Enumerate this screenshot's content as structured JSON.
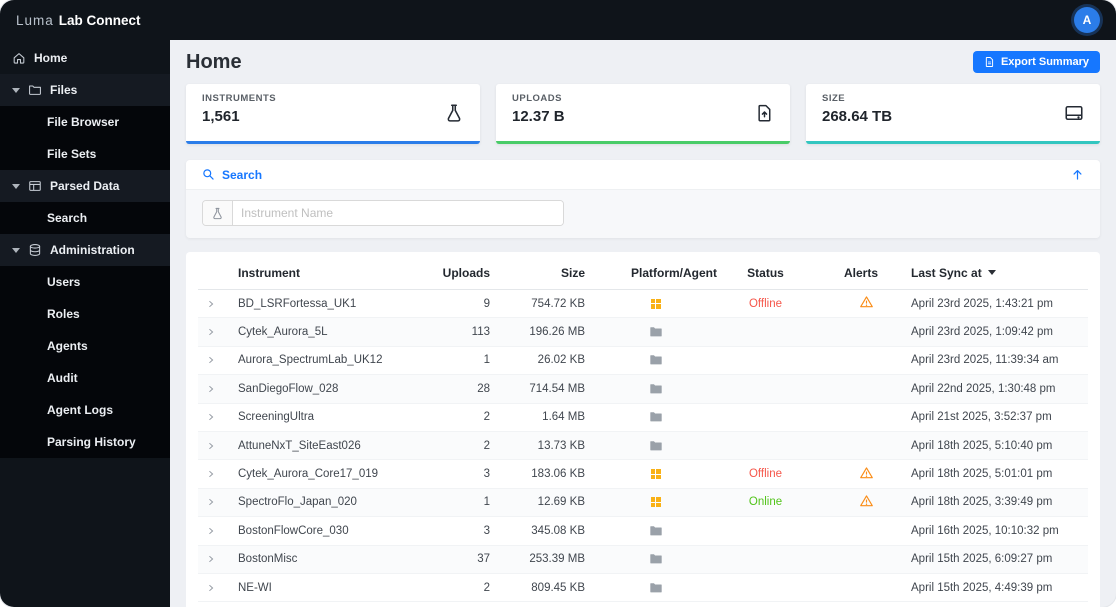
{
  "header": {
    "logo_primary": "Luma",
    "logo_secondary": "Lab Connect",
    "avatar_initial": "A"
  },
  "sidebar": {
    "home_label": "Home",
    "groups": [
      {
        "label": "Files",
        "children": [
          "File Browser",
          "File Sets"
        ]
      },
      {
        "label": "Parsed Data",
        "children": [
          "Search"
        ]
      },
      {
        "label": "Administration",
        "children": [
          "Users",
          "Roles",
          "Agents",
          "Audit",
          "Agent Logs",
          "Parsing History"
        ]
      }
    ]
  },
  "main": {
    "title": "Home",
    "export_button_label": "Export Summary",
    "cards": [
      {
        "label": "INSTRUMENTS",
        "value": "1,561",
        "icon": "instrument-icon",
        "accent": "#2b7de9"
      },
      {
        "label": "UPLOADS",
        "value": "12.37 B",
        "icon": "upload-file-icon",
        "accent": "#49cc68"
      },
      {
        "label": "SIZE",
        "value": "268.64 TB",
        "icon": "storage-icon",
        "accent": "#33c6c0"
      }
    ],
    "search_panel": {
      "title": "Search",
      "placeholder": "Instrument Name"
    },
    "table": {
      "columns": {
        "instrument": "Instrument",
        "uploads": "Uploads",
        "size": "Size",
        "platform": "Platform/Agent",
        "status": "Status",
        "alerts": "Alerts",
        "last_sync": "Last Sync at"
      },
      "sort": {
        "column": "Last Sync at",
        "direction": "desc"
      },
      "rows": [
        {
          "instrument": "BD_LSRFortessa_UK1",
          "uploads": "9",
          "size": "754.72 KB",
          "platform": "windows",
          "status": "Offline",
          "alert": true,
          "last_sync": "April 23rd 2025, 1:43:21 pm"
        },
        {
          "instrument": "Cytek_Aurora_5L",
          "uploads": "113",
          "size": "196.26 MB",
          "platform": "folder",
          "status": "",
          "alert": false,
          "last_sync": "April 23rd 2025, 1:09:42 pm"
        },
        {
          "instrument": "Aurora_SpectrumLab_UK12",
          "uploads": "1",
          "size": "26.02 KB",
          "platform": "folder",
          "status": "",
          "alert": false,
          "last_sync": "April 23rd 2025, 11:39:34 am"
        },
        {
          "instrument": "SanDiegoFlow_028",
          "uploads": "28",
          "size": "714.54 MB",
          "platform": "folder",
          "status": "",
          "alert": false,
          "last_sync": "April 22nd 2025, 1:30:48 pm"
        },
        {
          "instrument": "ScreeningUltra",
          "uploads": "2",
          "size": "1.64 MB",
          "platform": "folder",
          "status": "",
          "alert": false,
          "last_sync": "April 21st 2025, 3:52:37 pm"
        },
        {
          "instrument": "AttuneNxT_SiteEast026",
          "uploads": "2",
          "size": "13.73 KB",
          "platform": "folder",
          "status": "",
          "alert": false,
          "last_sync": "April 18th 2025, 5:10:40 pm"
        },
        {
          "instrument": "Cytek_Aurora_Core17_019",
          "uploads": "3",
          "size": "183.06 KB",
          "platform": "windows",
          "status": "Offline",
          "alert": true,
          "last_sync": "April 18th 2025, 5:01:01 pm"
        },
        {
          "instrument": "SpectroFlo_Japan_020",
          "uploads": "1",
          "size": "12.69 KB",
          "platform": "windows",
          "status": "Online",
          "alert": true,
          "last_sync": "April 18th 2025, 3:39:49 pm"
        },
        {
          "instrument": "BostonFlowCore_030",
          "uploads": "3",
          "size": "345.08 KB",
          "platform": "folder",
          "status": "",
          "alert": false,
          "last_sync": "April 16th 2025, 10:10:32 pm"
        },
        {
          "instrument": "BostonMisc",
          "uploads": "37",
          "size": "253.39 MB",
          "platform": "folder",
          "status": "",
          "alert": false,
          "last_sync": "April 15th 2025, 6:09:27 pm"
        },
        {
          "instrument": "NE-WI",
          "uploads": "2",
          "size": "809.45 KB",
          "platform": "folder",
          "status": "",
          "alert": false,
          "last_sync": "April 15th 2025, 4:49:39 pm"
        }
      ]
    }
  },
  "colors": {
    "accent_blue": "#2b7de9",
    "accent_green": "#49cc68",
    "accent_teal": "#33c6c0",
    "status_offline": "#f5564a",
    "status_online": "#52c41a",
    "warning_orange": "#fa8c16",
    "platform_yellow": "#f9b115",
    "sidebar_bg": "#0f141a"
  }
}
